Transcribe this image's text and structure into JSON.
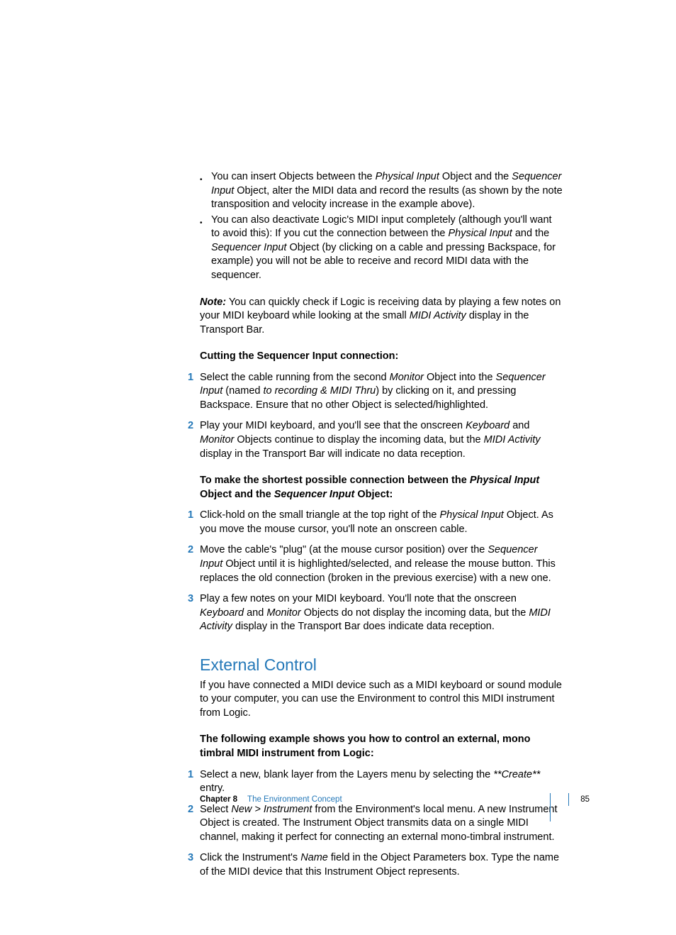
{
  "bullets": [
    {
      "parts": [
        {
          "t": "You can insert Objects between the "
        },
        {
          "t": "Physical Input",
          "i": true
        },
        {
          "t": " Object and the "
        },
        {
          "t": "Sequencer Input",
          "i": true
        },
        {
          "t": " Object, alter the MIDI data and record the results (as shown by the note transposition and velocity increase in the example above)."
        }
      ]
    },
    {
      "parts": [
        {
          "t": "You can also deactivate Logic's MIDI input completely (although you'll want to avoid this):  If you cut the connection between the "
        },
        {
          "t": "Physical Input",
          "i": true
        },
        {
          "t": " and the "
        },
        {
          "t": "Sequencer Input",
          "i": true
        },
        {
          "t": " Object (by clicking on a cable and pressing Backspace, for example) you will not be able to receive and record MIDI data with the sequencer."
        }
      ]
    }
  ],
  "note": {
    "prefix": "Note:",
    "parts": [
      {
        "t": "  You can quickly check if Logic is receiving data by playing a few notes on your MIDI keyboard while looking at the small "
      },
      {
        "t": "MIDI Activity",
        "i": true
      },
      {
        "t": " display in the Transport Bar."
      }
    ]
  },
  "proc1": {
    "title": "Cutting the Sequencer Input connection:",
    "steps": [
      {
        "n": "1",
        "parts": [
          {
            "t": "Select the cable running from the second "
          },
          {
            "t": "Monitor",
            "i": true
          },
          {
            "t": " Object into the "
          },
          {
            "t": "Sequencer Input",
            "i": true
          },
          {
            "t": " (named "
          },
          {
            "t": "to recording & MIDI Thru",
            "i": true
          },
          {
            "t": ") by clicking on it, and pressing Backspace. Ensure that no other Object is selected/highlighted."
          }
        ]
      },
      {
        "n": "2",
        "parts": [
          {
            "t": "Play your MIDI keyboard, and you'll see that the onscreen "
          },
          {
            "t": "Keyboard",
            "i": true
          },
          {
            "t": " and "
          },
          {
            "t": "Monitor",
            "i": true
          },
          {
            "t": " Objects continue to display the incoming data, but the "
          },
          {
            "t": "MIDI Activity",
            "i": true
          },
          {
            "t": " display in the Transport Bar will indicate no data reception."
          }
        ]
      }
    ]
  },
  "proc2": {
    "title_parts": [
      {
        "t": "To make the shortest possible connection between the "
      },
      {
        "t": "Physical Input",
        "bi": true
      },
      {
        "t": " Object and the "
      },
      {
        "t": "Sequencer Input",
        "bi": true
      },
      {
        "t": " Object:"
      }
    ],
    "steps": [
      {
        "n": "1",
        "parts": [
          {
            "t": "Click-hold on the small triangle at the top right of the "
          },
          {
            "t": "Physical Input",
            "i": true
          },
          {
            "t": " Object. As you move the mouse cursor, you'll note an onscreen cable."
          }
        ]
      },
      {
        "n": "2",
        "parts": [
          {
            "t": "Move the cable's \"plug\" (at the mouse cursor position) over the "
          },
          {
            "t": "Sequencer Input",
            "i": true
          },
          {
            "t": " Object until it is highlighted/selected, and release the mouse button. This replaces the old connection (broken in the previous exercise) with a new one."
          }
        ]
      },
      {
        "n": "3",
        "parts": [
          {
            "t": "Play a few notes on your MIDI keyboard. You'll note that the onscreen "
          },
          {
            "t": "Keyboard",
            "i": true
          },
          {
            "t": " and "
          },
          {
            "t": "Monitor",
            "i": true
          },
          {
            "t": " Objects do not display the incoming data, but the "
          },
          {
            "t": "MIDI Activity",
            "i": true
          },
          {
            "t": " display in the Transport Bar does indicate data reception."
          }
        ]
      }
    ]
  },
  "section": {
    "heading": "External Control",
    "intro": "If you have connected a MIDI device such as a MIDI keyboard or sound module to your computer, you can use the Environment to control this MIDI instrument from Logic."
  },
  "proc3": {
    "title": "The following example shows you how to control an external, mono timbral MIDI instrument from Logic:",
    "steps": [
      {
        "n": "1",
        "parts": [
          {
            "t": "Select a new, blank layer from the Layers menu by selecting the "
          },
          {
            "t": "**Create**",
            "i": true
          },
          {
            "t": " entry."
          }
        ]
      },
      {
        "n": "2",
        "parts": [
          {
            "t": "Select "
          },
          {
            "t": "New > Instrument",
            "i": true
          },
          {
            "t": " from the Environment's local menu. A new Instrument Object is created. The Instrument Object transmits data on a single MIDI channel, making it perfect for connecting an external mono-timbral instrument."
          }
        ]
      },
      {
        "n": "3",
        "parts": [
          {
            "t": "Click the Instrument's "
          },
          {
            "t": "Name",
            "i": true
          },
          {
            "t": " field in the Object Parameters box. Type the name of the MIDI device that this Instrument Object represents."
          }
        ]
      }
    ]
  },
  "footer": {
    "chapter": "Chapter 8",
    "title": "The Environment Concept",
    "page": "85"
  }
}
